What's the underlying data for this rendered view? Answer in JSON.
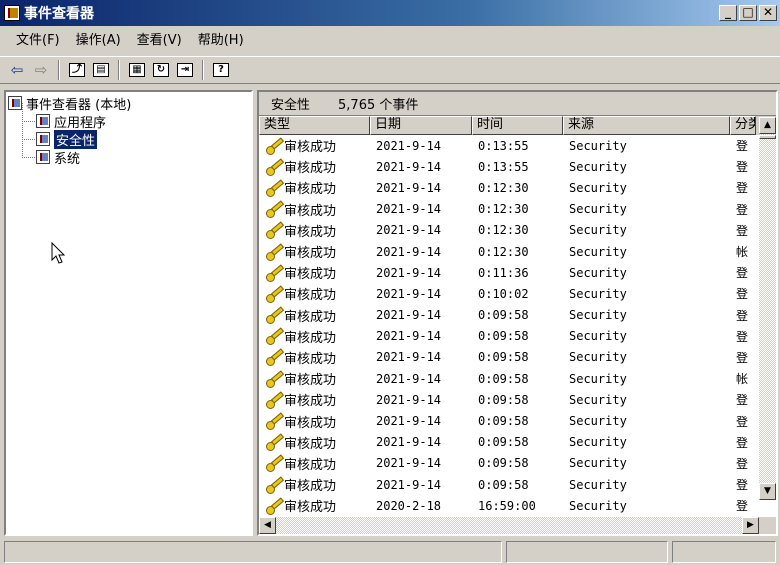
{
  "window": {
    "title": "事件查看器",
    "min_glyph": "_",
    "max_glyph": "□",
    "close_glyph": "✕"
  },
  "menu": [
    "文件(F)",
    "操作(A)",
    "查看(V)",
    "帮助(H)"
  ],
  "toolbar": {
    "back_glyph": "⇦",
    "forward_glyph": "⇨",
    "up_glyph": "⤴",
    "tree_glyph": "▤",
    "props_glyph": "▦",
    "refresh_glyph": "↻",
    "export_glyph": "⇥",
    "help_glyph": "?"
  },
  "tree": {
    "root": "事件查看器 (本地)",
    "children": [
      "应用程序",
      "安全性",
      "系统"
    ],
    "selected_index": 1
  },
  "list": {
    "log_name": "安全性",
    "event_count": "5,765 个事件",
    "columns": [
      "类型",
      "日期",
      "时间",
      "来源",
      "分类"
    ],
    "rows": [
      {
        "type": "审核成功",
        "date": "2021-9-14",
        "time": "0:13:55",
        "source": "Security",
        "category": "登"
      },
      {
        "type": "审核成功",
        "date": "2021-9-14",
        "time": "0:13:55",
        "source": "Security",
        "category": "登"
      },
      {
        "type": "审核成功",
        "date": "2021-9-14",
        "time": "0:12:30",
        "source": "Security",
        "category": "登"
      },
      {
        "type": "审核成功",
        "date": "2021-9-14",
        "time": "0:12:30",
        "source": "Security",
        "category": "登"
      },
      {
        "type": "审核成功",
        "date": "2021-9-14",
        "time": "0:12:30",
        "source": "Security",
        "category": "登"
      },
      {
        "type": "审核成功",
        "date": "2021-9-14",
        "time": "0:12:30",
        "source": "Security",
        "category": "帐"
      },
      {
        "type": "审核成功",
        "date": "2021-9-14",
        "time": "0:11:36",
        "source": "Security",
        "category": "登"
      },
      {
        "type": "审核成功",
        "date": "2021-9-14",
        "time": "0:10:02",
        "source": "Security",
        "category": "登"
      },
      {
        "type": "审核成功",
        "date": "2021-9-14",
        "time": "0:09:58",
        "source": "Security",
        "category": "登"
      },
      {
        "type": "审核成功",
        "date": "2021-9-14",
        "time": "0:09:58",
        "source": "Security",
        "category": "登"
      },
      {
        "type": "审核成功",
        "date": "2021-9-14",
        "time": "0:09:58",
        "source": "Security",
        "category": "登"
      },
      {
        "type": "审核成功",
        "date": "2021-9-14",
        "time": "0:09:58",
        "source": "Security",
        "category": "帐"
      },
      {
        "type": "审核成功",
        "date": "2021-9-14",
        "time": "0:09:58",
        "source": "Security",
        "category": "登"
      },
      {
        "type": "审核成功",
        "date": "2021-9-14",
        "time": "0:09:58",
        "source": "Security",
        "category": "登"
      },
      {
        "type": "审核成功",
        "date": "2021-9-14",
        "time": "0:09:58",
        "source": "Security",
        "category": "登"
      },
      {
        "type": "审核成功",
        "date": "2021-9-14",
        "time": "0:09:58",
        "source": "Security",
        "category": "登"
      },
      {
        "type": "审核成功",
        "date": "2021-9-14",
        "time": "0:09:58",
        "source": "Security",
        "category": "登"
      },
      {
        "type": "审核成功",
        "date": "2020-2-18",
        "time": "16:59:00",
        "source": "Security",
        "category": "登"
      }
    ]
  },
  "scroll": {
    "up_glyph": "▲",
    "down_glyph": "▼",
    "left_glyph": "◀",
    "right_glyph": "▶"
  },
  "colors": {
    "titlebar": "#0a246a",
    "selection": "#0a246a",
    "window_bg": "#d4d0c8"
  }
}
